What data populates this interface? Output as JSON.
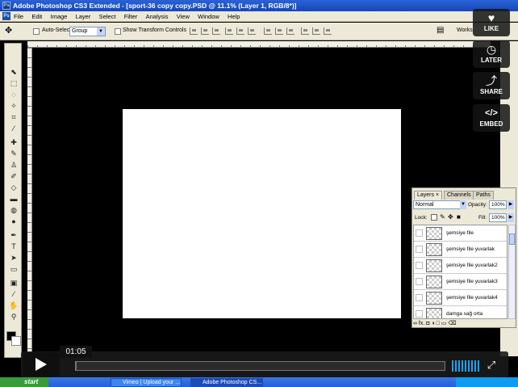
{
  "window": {
    "title": "Adobe Photoshop CS3 Extended - [sport-36 copy copy.PSD @ 11.1% (Layer 1, RGB/8*)]",
    "app_badge": "Ps"
  },
  "menu": [
    "File",
    "Edit",
    "Image",
    "Layer",
    "Select",
    "Filter",
    "Analysis",
    "View",
    "Window",
    "Help"
  ],
  "options_bar": {
    "auto_select_label": "Auto-Select:",
    "auto_select_value": "Group",
    "transform_label": "Show Transform Controls",
    "workspace_label": "Works"
  },
  "layers_panel": {
    "tabs": [
      "Layers",
      "Channels",
      "Paths"
    ],
    "tab_close": "×",
    "blend_mode": "Normal",
    "opacity_label": "Opacity:",
    "opacity_value": "100%",
    "lock_label": "Lock:",
    "fill_label": "Fill:",
    "fill_value": "100%",
    "layers": [
      {
        "name": "şemsiye file"
      },
      {
        "name": "şemsiye file yuvarlak"
      },
      {
        "name": "şemsiye file yuvarlak2"
      },
      {
        "name": "şemsiye file yuvarlak3"
      },
      {
        "name": "şemsiye file yuvarlak4"
      },
      {
        "name": "damga sağ orta"
      }
    ],
    "footer_icons": "∞ fx. ◘ ◑ □ ▭ ⌫"
  },
  "video_overlay": {
    "like_label": "LIKE",
    "later_label": "LATER",
    "share_label": "SHARE",
    "embed_label": "EMBED",
    "embed_icon": "</>",
    "timecode": "01:05",
    "progress": 0.002
  },
  "taskbar": {
    "start_label": "start",
    "tasks": [
      "Vimeo | Upload your ...",
      "Adobe Photoshop CS..."
    ]
  }
}
